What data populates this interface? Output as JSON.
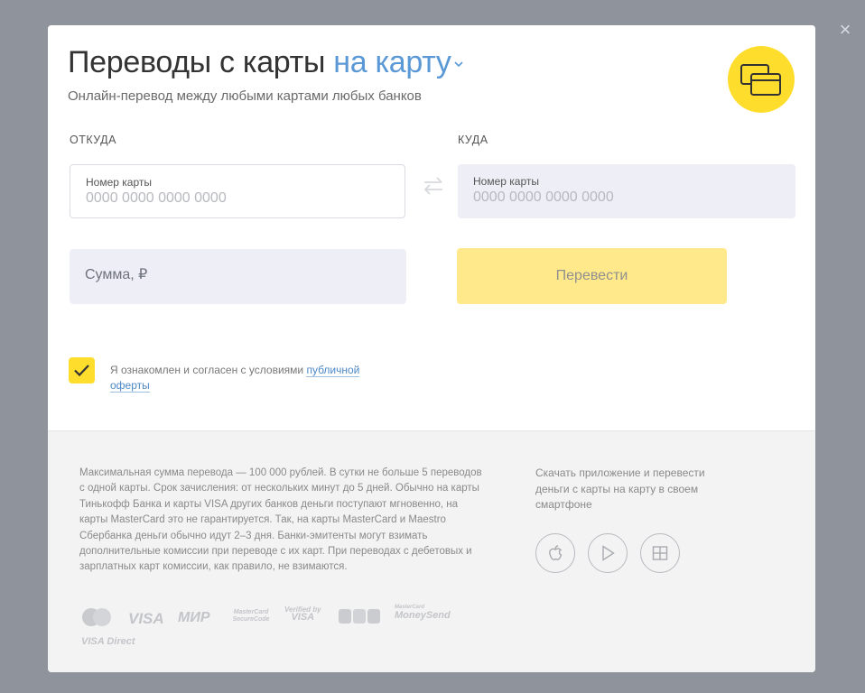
{
  "header": {
    "title_main": "Переводы с карты",
    "title_accent": "на карту",
    "subtitle": "Онлайн-перевод между любыми картами любых банков"
  },
  "form": {
    "from_label": "ОТКУДА",
    "to_label": "КУДА",
    "from_card": {
      "label": "Номер карты",
      "placeholder": "0000 0000 0000 0000"
    },
    "to_card": {
      "label": "Номер карты",
      "placeholder": "0000 0000 0000 0000"
    },
    "amount_placeholder": "Сумма, ₽",
    "submit_label": "Перевести",
    "agreement_text": "Я ознакомлен и согласен с условиями",
    "agreement_link": "публичной оферты",
    "agreement_checked": true
  },
  "footer": {
    "info_text": "Максимальная сумма перевода — 100 000 рублей. В сутки не больше 5 переводов с одной карты. Срок зачисления: от нескольких минут до 5 дней. Обычно на карты Тинькофф Банка и карты VISA других банков деньги поступают мгновенно, на карты MasterCard это не гарантируется. Так, на карты MasterCard и Maestro Сбербанка деньги обычно идут 2–3 дня. Банки-эмитенты могут взимать дополнительные комиссии при переводе с их карт. При переводах с дебетовых и зарплатных карт комиссии, как правило, не взимаются.",
    "payment_logos": {
      "visa": "VISA",
      "mir": "МИР",
      "mastercard_secure": "MasterCard SecureCode",
      "verified_visa_1": "Verified by",
      "verified_visa_2": "VISA",
      "mastercard_moneysend_1": "MasterCard",
      "mastercard_moneysend_2": "MoneySend",
      "visa_direct": "VISA Direct"
    },
    "app_text": "Скачать приложение и перевести деньги с карты на карту в своем смартфоне",
    "stores": [
      "apple-icon",
      "google-play-icon",
      "windows-icon"
    ]
  },
  "colors": {
    "accent_yellow": "#ffdd2d",
    "button_disabled": "#ffe98a",
    "link_blue": "#5a99d6",
    "overlay": "#8e939c"
  }
}
